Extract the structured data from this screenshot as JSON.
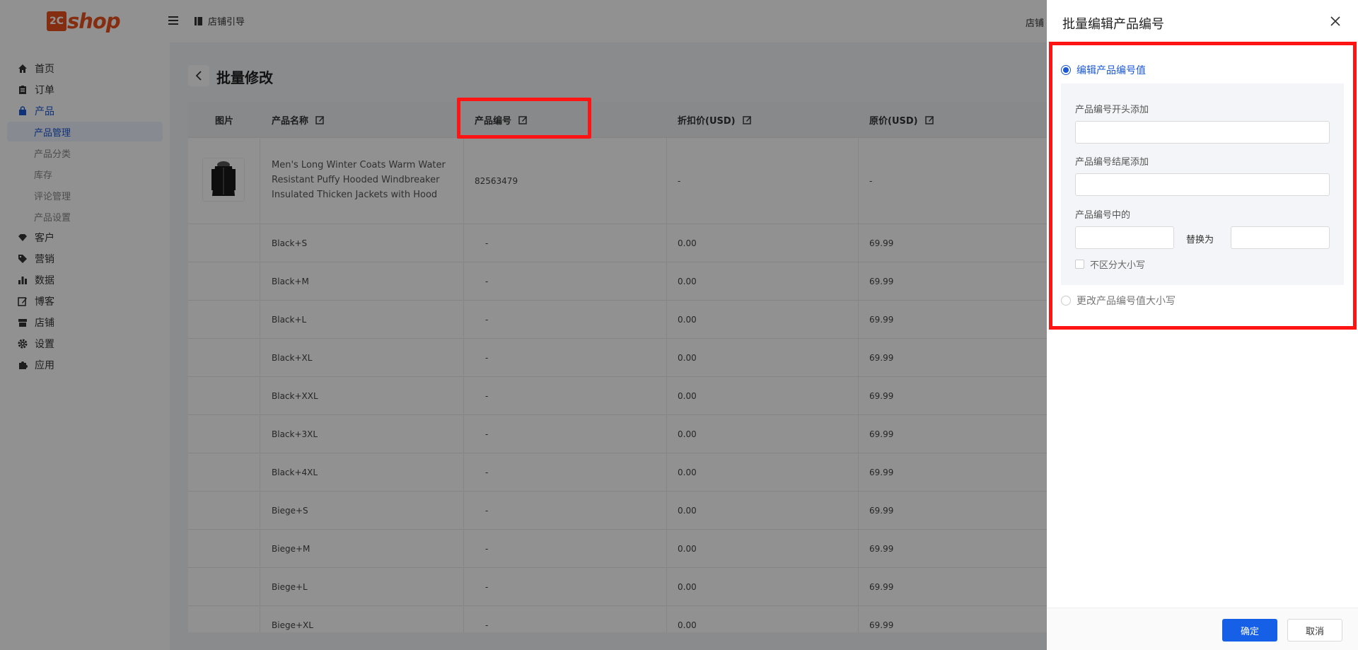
{
  "header": {
    "logo_badge": "2C",
    "logo_word": "shop",
    "store_guide": "店铺引导",
    "right_text": "店铺"
  },
  "sidebar": {
    "items": [
      {
        "label": "首页",
        "icon": "home-icon"
      },
      {
        "label": "订单",
        "icon": "clipboard-icon"
      },
      {
        "label": "产品",
        "icon": "bag-icon",
        "active": true
      },
      {
        "label": "客户",
        "icon": "diamond-icon"
      },
      {
        "label": "营销",
        "icon": "tag-icon"
      },
      {
        "label": "数据",
        "icon": "bar-chart-icon"
      },
      {
        "label": "博客",
        "icon": "edit-icon"
      },
      {
        "label": "店铺",
        "icon": "store-icon"
      },
      {
        "label": "设置",
        "icon": "gear-icon"
      },
      {
        "label": "应用",
        "icon": "puzzle-icon"
      }
    ],
    "product_sub": [
      "产品管理",
      "产品分类",
      "库存",
      "评论管理",
      "产品设置"
    ]
  },
  "page": {
    "title": "批量修改"
  },
  "table": {
    "headers": [
      "图片",
      "产品名称",
      "产品编号",
      "折扣价(USD)",
      "原价(USD)"
    ],
    "product": {
      "name": "Men's Long Winter Coats Warm Water Resistant Puffy Hooded Windbreaker Insulated Thicken Jackets with Hood",
      "sku": "82563479",
      "discount": "-",
      "price": "-"
    },
    "variants": [
      {
        "name": "Black+S",
        "sku": "-",
        "discount": "0.00",
        "price": "69.99"
      },
      {
        "name": "Black+M",
        "sku": "-",
        "discount": "0.00",
        "price": "69.99"
      },
      {
        "name": "Black+L",
        "sku": "-",
        "discount": "0.00",
        "price": "69.99"
      },
      {
        "name": "Black+XL",
        "sku": "-",
        "discount": "0.00",
        "price": "69.99"
      },
      {
        "name": "Black+XXL",
        "sku": "-",
        "discount": "0.00",
        "price": "69.99"
      },
      {
        "name": "Black+3XL",
        "sku": "-",
        "discount": "0.00",
        "price": "69.99"
      },
      {
        "name": "Black+4XL",
        "sku": "-",
        "discount": "0.00",
        "price": "69.99"
      },
      {
        "name": "Biege+S",
        "sku": "-",
        "discount": "0.00",
        "price": "69.99"
      },
      {
        "name": "Biege+M",
        "sku": "-",
        "discount": "0.00",
        "price": "69.99"
      },
      {
        "name": "Biege+L",
        "sku": "-",
        "discount": "0.00",
        "price": "69.99"
      },
      {
        "name": "Biege+XL",
        "sku": "-",
        "discount": "0.00",
        "price": "69.99"
      }
    ]
  },
  "drawer": {
    "title": "批量编辑产品编号",
    "option_edit": "编辑产品编号值",
    "prefix_label": "产品编号开头添加",
    "prefix_value": "",
    "suffix_label": "产品编号结尾添加",
    "suffix_value": "",
    "replace_label": "产品编号中的",
    "replace_find_value": "",
    "replace_with_label": "替换为",
    "replace_with_value": "",
    "case_insensitive": "不区分大小写",
    "option_case": "更改产品编号值大小写",
    "confirm": "确定",
    "cancel": "取消"
  },
  "colors": {
    "accent": "#1660e8",
    "brand": "#e8501e",
    "highlight": "#ff1414"
  }
}
